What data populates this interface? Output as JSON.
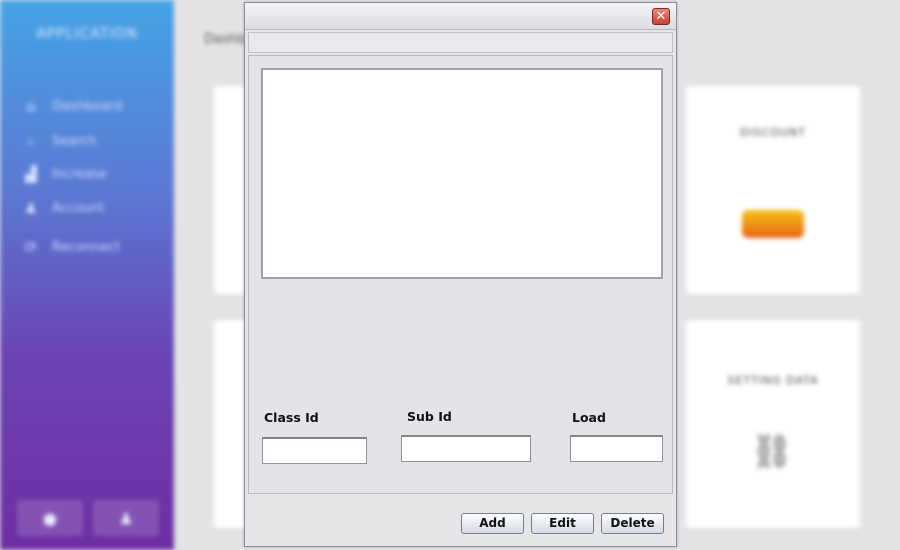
{
  "background_app": {
    "title": "APPLICATION",
    "breadcrumb": "Dashboard",
    "nav_items": [
      {
        "label": "Dashboard",
        "icon": "home-icon"
      },
      {
        "label": "Search",
        "icon": "search-icon"
      },
      {
        "label": "Increase",
        "icon": "bar-chart-icon"
      },
      {
        "label": "Account",
        "icon": "user-icon"
      },
      {
        "label": "Reconnect",
        "icon": "refresh-icon"
      }
    ],
    "cards": [
      {
        "title": "DISCOUNT"
      },
      {
        "title": "SETTING DATA"
      }
    ],
    "colors": {
      "sidebar_top": "#45a4e6",
      "sidebar_bottom": "#6d2fa3"
    }
  },
  "dialog": {
    "close_symbol": "✕",
    "text_area_value": "",
    "fields": {
      "class_id": {
        "label": "Class Id",
        "value": ""
      },
      "sub_id": {
        "label": "Sub Id",
        "value": ""
      },
      "load": {
        "label": "Load",
        "value": ""
      }
    },
    "buttons": {
      "add": "Add",
      "edit": "Edit",
      "delete": "Delete"
    }
  }
}
